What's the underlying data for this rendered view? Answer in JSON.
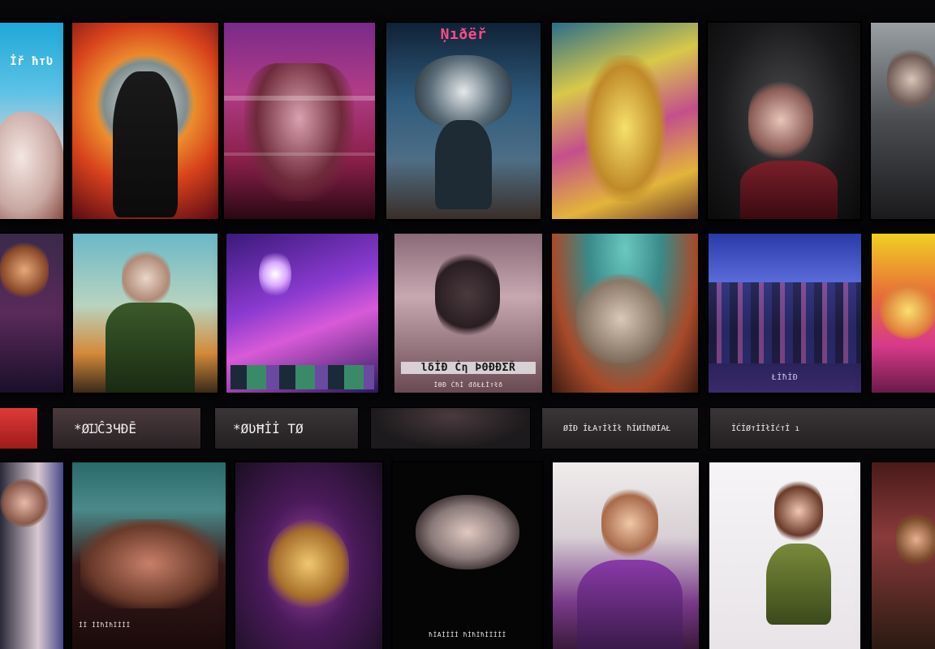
{
  "row1": {
    "p1": {
      "title": "İř ħтƲ"
    },
    "p2": {},
    "p3": {},
    "p4": {
      "banner": "Ņıðёř"
    },
    "p5": {},
    "p6": {},
    "p7": {}
  },
  "row2": {
    "p1": {},
    "p2": {},
    "p3": {},
    "p4": {
      "title": "lδİĐ Ċη ÞΘĐĐΣŘ",
      "subtitle": "İƟĐ Ċħİ đðŁŁİтłð"
    },
    "p5": {},
    "p6": {
      "footer": "ŁİħİĐ"
    },
    "p7": {}
  },
  "chips": [
    {
      "label": ""
    },
    {
      "label": "*ØĲĈЗЧÐĒ"
    },
    {
      "label": "*ØƲĦİİ ТØ"
    },
    {
      "label": ""
    },
    {
      "label": "ØİĐ İŁАтİłİł ħİИİħØİАŁ"
    },
    {
      "label": "İĆİØтİİłİćтİ ı"
    }
  ],
  "row3": {
    "p1": {},
    "p2": {
      "caption": "İİ İİħİħİİİİ"
    },
    "p3": {},
    "p4": {
      "caption": "ħİАİİİİ ħİħİħİİİİİ"
    },
    "p5": {},
    "p6": {},
    "p7": {}
  }
}
